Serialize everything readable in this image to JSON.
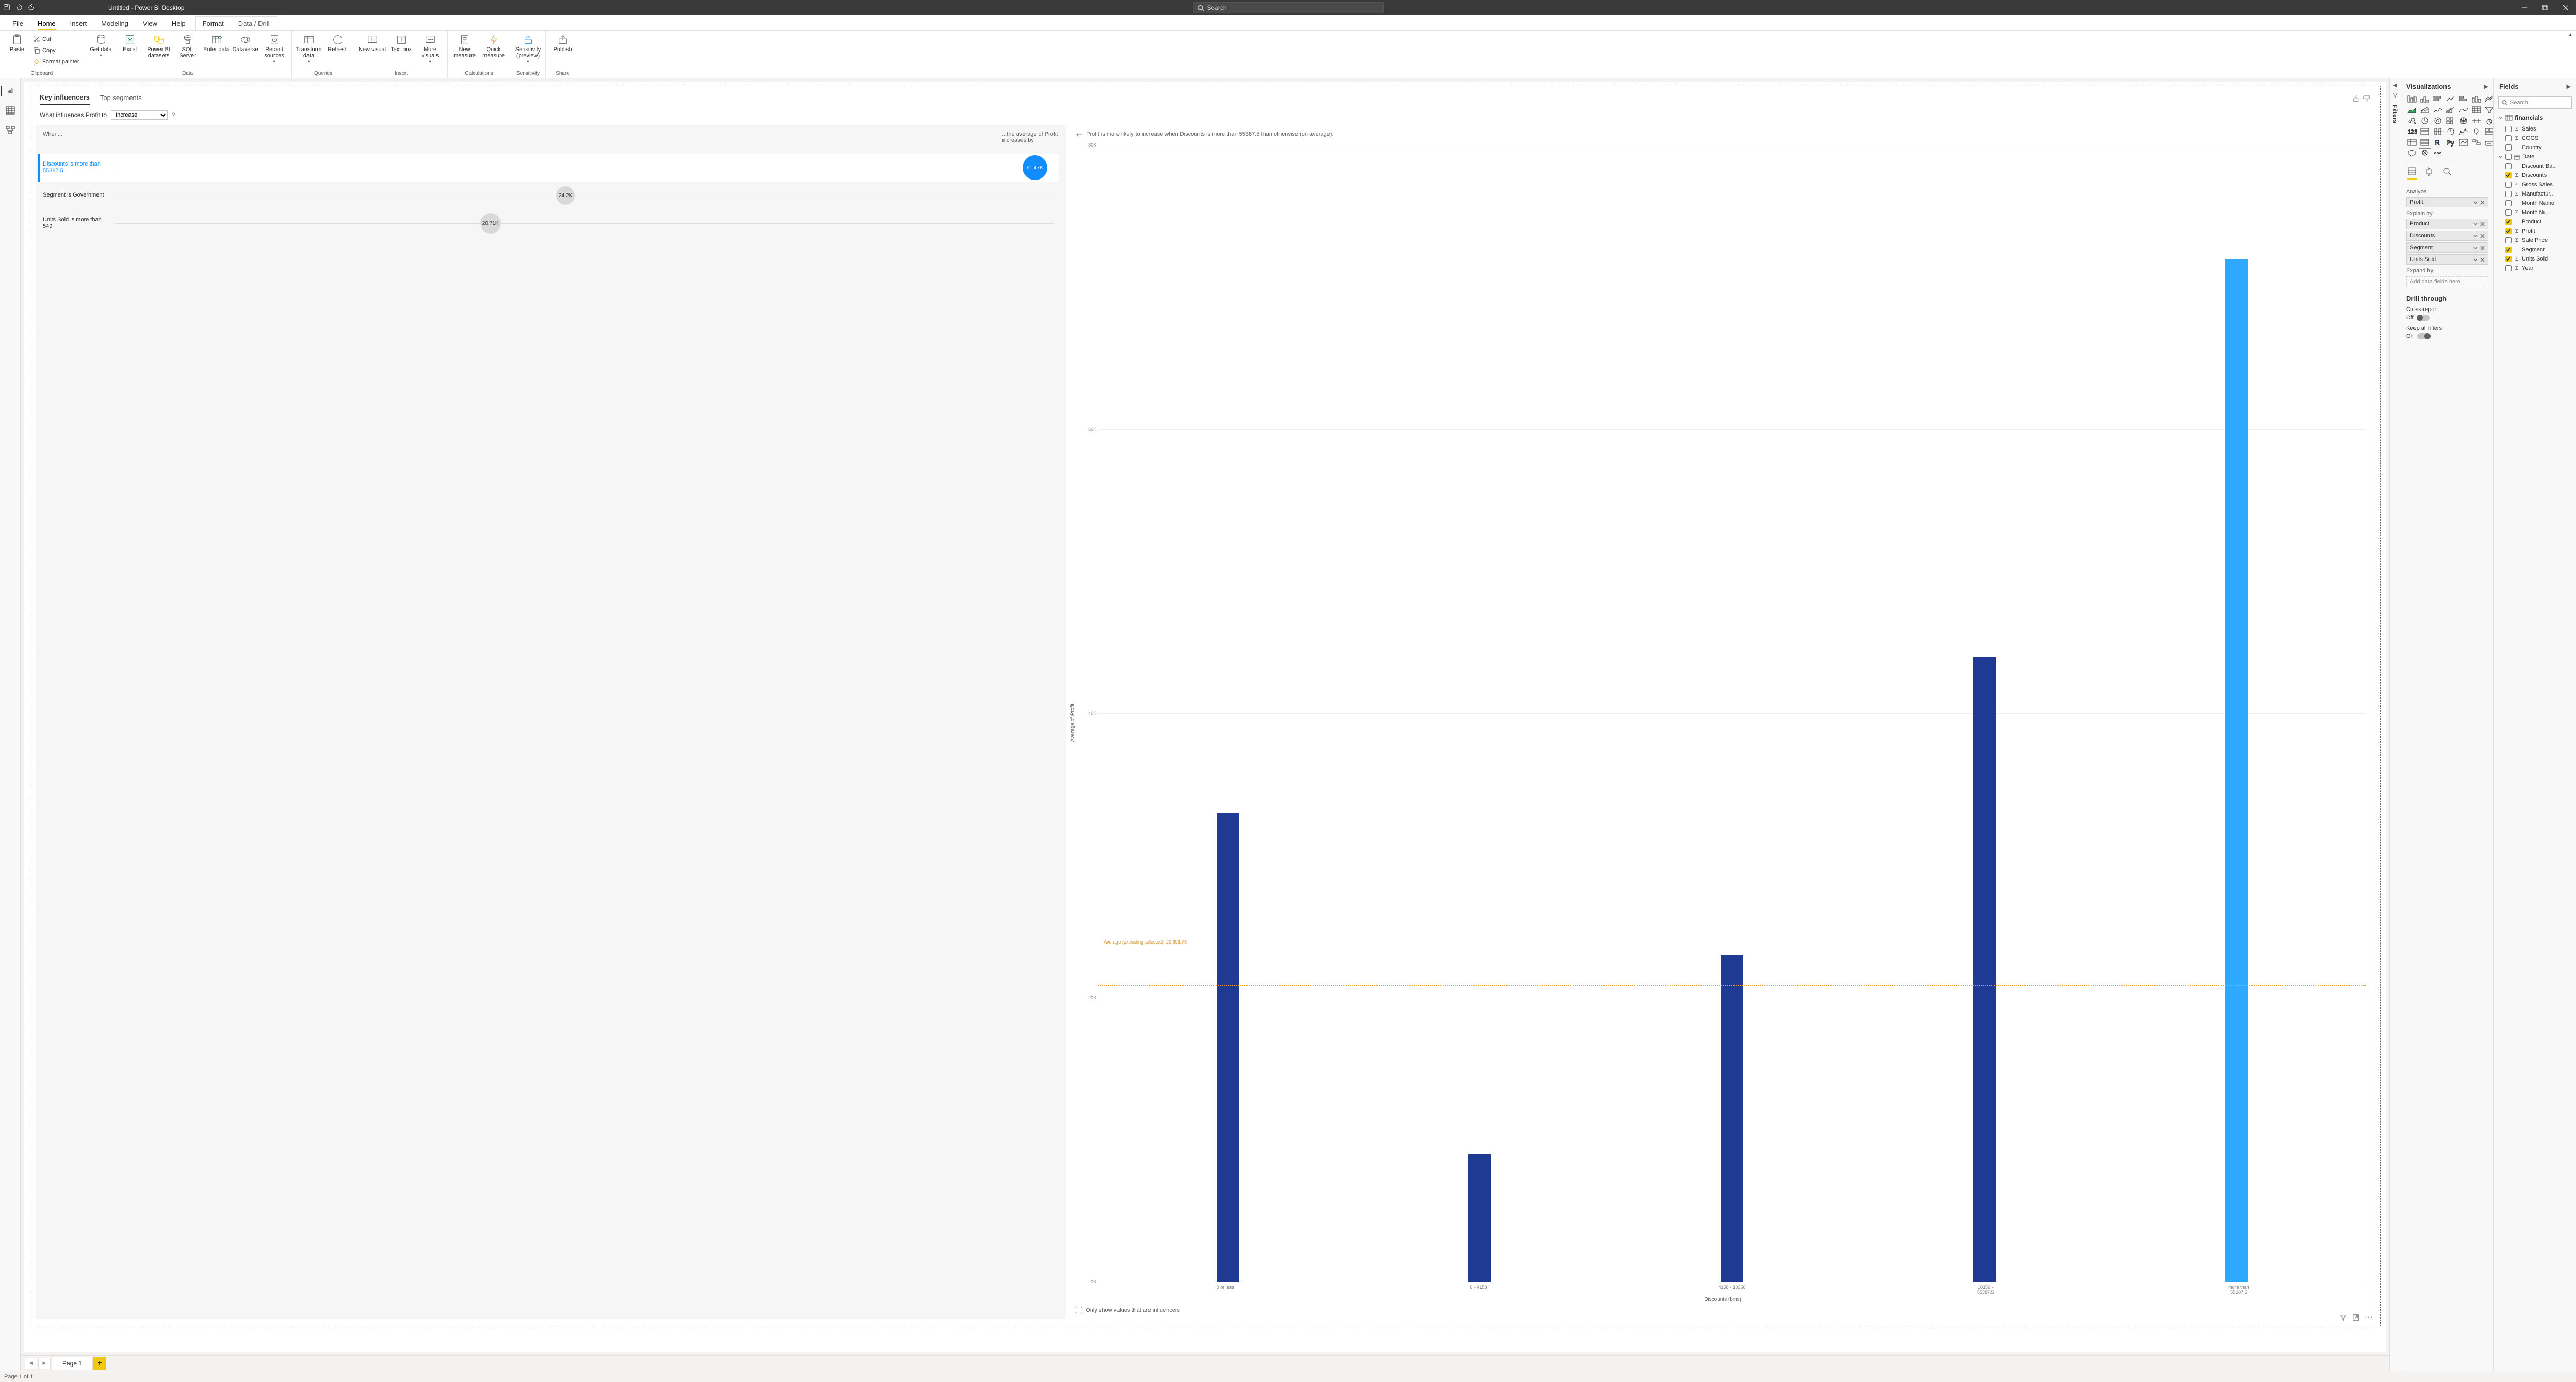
{
  "titlebar": {
    "title": "Untitled - Power BI Desktop",
    "search_ph": "Search"
  },
  "menutabs": {
    "file": "File",
    "home": "Home",
    "insert": "Insert",
    "modeling": "Modeling",
    "view": "View",
    "help": "Help",
    "format": "Format",
    "datadrill": "Data / Drill"
  },
  "ribbon": {
    "clipboard": {
      "paste": "Paste",
      "cut": "Cut",
      "copy": "Copy",
      "fmt": "Format painter",
      "label": "Clipboard"
    },
    "data": {
      "get": "Get data",
      "excel": "Excel",
      "pbi": "Power BI datasets",
      "sql": "SQL Server",
      "enter": "Enter data",
      "dv": "Dataverse",
      "recent": "Recent sources",
      "label": "Data"
    },
    "queries": {
      "transform": "Transform data",
      "refresh": "Refresh",
      "label": "Queries"
    },
    "insert": {
      "newvis": "New visual",
      "text": "Text box",
      "more": "More visuals",
      "label": "Insert"
    },
    "calc": {
      "newm": "New measure",
      "quick": "Quick measure",
      "label": "Calculations"
    },
    "sens": {
      "sens": "Sensitivity (preview)",
      "label": "Sensitivity"
    },
    "share": {
      "pub": "Publish",
      "label": "Share"
    }
  },
  "ki": {
    "tab1": "Key influencers",
    "tab2": "Top segments",
    "q_prefix": "What influences Profit to",
    "q_sel": "Increase",
    "q_mark": "?",
    "when": "When...",
    "increases": "...the average of Profit increases by",
    "rows": [
      {
        "desc_l1": "Discounts is more than",
        "desc_l2": "55387.5",
        "val": "51.47K",
        "sel": true,
        "size": 48,
        "pos": 98
      },
      {
        "desc_l1": "Segment is Government",
        "desc_l2": "",
        "val": "24.2K",
        "sel": false,
        "size": 36,
        "pos": 48
      },
      {
        "desc_l1": "Units Sold is more than 549",
        "desc_l2": "",
        "val": "20.71K",
        "sel": false,
        "size": 40,
        "pos": 40
      }
    ],
    "chart_caption": "Profit is more likely to increase when Discounts is more than 55387.5 than otherwise (on average).",
    "only_label": "Only show values that are influencers"
  },
  "chart_data": {
    "type": "bar",
    "ylabel": "Average of Profit",
    "xlabel": "Discounts (bins)",
    "ylim": [
      0,
      80000
    ],
    "yticks": [
      "0K",
      "20K",
      "40K",
      "60K",
      "80K"
    ],
    "avg_label": "Average (excluding selected): 20,898.75",
    "avg_value": 20898.75,
    "categories": [
      "0 or less",
      "0 - 4158",
      "4158 - 10350",
      "10350 - 55387.5",
      "more than 55387.5"
    ],
    "values": [
      33000,
      9000,
      23000,
      44000,
      72000
    ],
    "highlight_index": 4
  },
  "pages": {
    "page1": "Page 1"
  },
  "status": "Page 1 of 1",
  "filters_label": "Filters",
  "viz": {
    "title": "Visualizations",
    "analyze": "Analyze",
    "analyze_item": "Profit",
    "explain": "Explain by",
    "explain_items": [
      "Product",
      "Discounts",
      "Segment",
      "Units Sold"
    ],
    "expand": "Expand by",
    "expand_ph": "Add data fields here",
    "drill": "Drill through",
    "cross": "Cross-report",
    "off": "Off",
    "keep": "Keep all filters",
    "on": "On"
  },
  "fields": {
    "title": "Fields",
    "search_ph": "Search",
    "table": "financials",
    "items": [
      {
        "name": "Sales",
        "sigma": true,
        "checked": false
      },
      {
        "name": "COGS",
        "sigma": true,
        "checked": false
      },
      {
        "name": "Country",
        "sigma": false,
        "checked": false
      },
      {
        "name": "Date",
        "sigma": false,
        "checked": false,
        "date": true,
        "expand": true
      },
      {
        "name": "Discount Ba..",
        "sigma": false,
        "checked": false
      },
      {
        "name": "Discounts",
        "sigma": true,
        "checked": true
      },
      {
        "name": "Gross Sales",
        "sigma": true,
        "checked": false
      },
      {
        "name": "Manufactur..",
        "sigma": true,
        "checked": false
      },
      {
        "name": "Month Name",
        "sigma": false,
        "checked": false
      },
      {
        "name": "Month Nu..",
        "sigma": true,
        "checked": false
      },
      {
        "name": "Product",
        "sigma": false,
        "checked": true
      },
      {
        "name": "Profit",
        "sigma": true,
        "checked": true
      },
      {
        "name": "Sale Price",
        "sigma": true,
        "checked": false
      },
      {
        "name": "Segment",
        "sigma": false,
        "checked": true
      },
      {
        "name": "Units Sold",
        "sigma": true,
        "checked": true
      },
      {
        "name": "Year",
        "sigma": true,
        "checked": false
      }
    ]
  }
}
